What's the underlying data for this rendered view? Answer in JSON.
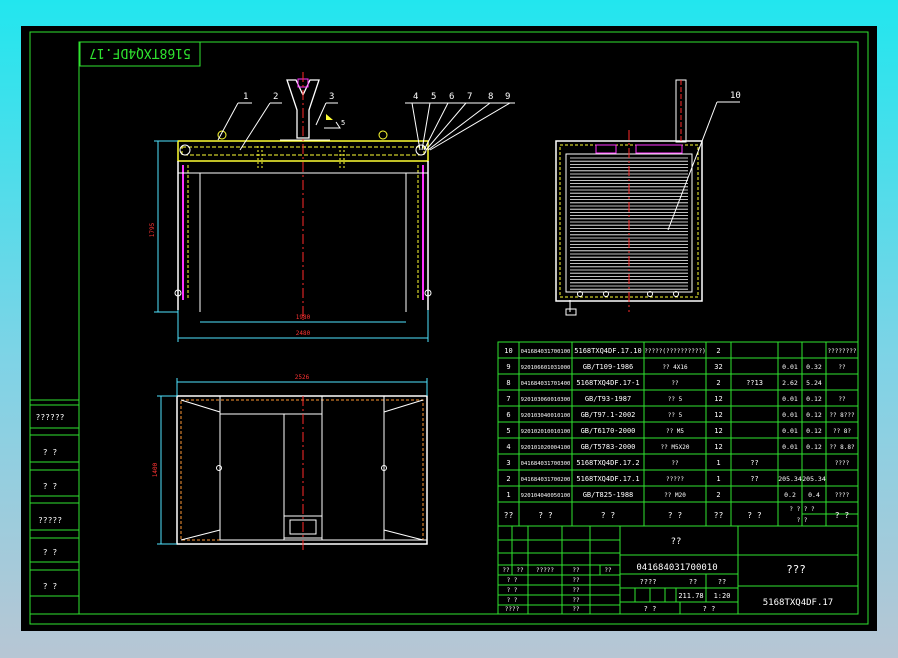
{
  "drawing": {
    "mirrored_title": "5168TXQ4DF.17",
    "side_view_labels": [
      "1",
      "2",
      "3",
      "4",
      "5",
      "6",
      "7",
      "8",
      "9"
    ],
    "side_view_dim_height": "1795",
    "side_view_dim_inner": "1980",
    "side_view_dim_width": "2480",
    "side_view_weld_symbol": "5",
    "end_view_label": "10",
    "top_view_dim_width": "2526",
    "top_view_dim_height": "1400",
    "left_block_cells": [
      "??????",
      "? ?",
      "? ?",
      "?????",
      "? ?",
      "? ?"
    ]
  },
  "bom": {
    "rows": [
      {
        "no": "10",
        "code": "041684031700100",
        "std": "5168TXQ4DF.17.10",
        "name": "?????(??????????)",
        "qty": "2",
        "mat": "",
        "unit": "",
        "total": "",
        "note": "????????"
      },
      {
        "no": "9",
        "code": "920106601031000",
        "std": "GB/T109-1986",
        "name": "?? 4X16",
        "qty": "32",
        "mat": "",
        "unit": "0.01",
        "total": "0.32",
        "note": "??"
      },
      {
        "no": "8",
        "code": "041684031701400",
        "std": "5168TXQ4DF.17-1",
        "name": "??",
        "qty": "2",
        "mat": "??13",
        "unit": "2.62",
        "total": "5.24",
        "note": ""
      },
      {
        "no": "7",
        "code": "920103060010300",
        "std": "GB/T93-1987",
        "name": "?? 5",
        "qty": "12",
        "mat": "",
        "unit": "0.01",
        "total": "0.12",
        "note": "??"
      },
      {
        "no": "6",
        "code": "920103040010100",
        "std": "GB/T97.1-2002",
        "name": "?? 5",
        "qty": "12",
        "mat": "",
        "unit": "0.01",
        "total": "0.12",
        "note": "?? 8???"
      },
      {
        "no": "5",
        "code": "920102010010100",
        "std": "GB/T6170-2000",
        "name": "?? M5",
        "qty": "12",
        "mat": "",
        "unit": "0.01",
        "total": "0.12",
        "note": "?? 8?"
      },
      {
        "no": "4",
        "code": "920101020004100",
        "std": "GB/T5783-2000",
        "name": "?? M5X20",
        "qty": "12",
        "mat": "",
        "unit": "0.01",
        "total": "0.12",
        "note": "?? 8.8?"
      },
      {
        "no": "3",
        "code": "041684031700300",
        "std": "5168TXQ4DF.17.2",
        "name": "??",
        "qty": "1",
        "mat": "??",
        "unit": "",
        "total": "",
        "note": "????"
      },
      {
        "no": "2",
        "code": "041684031700200",
        "std": "5168TXQ4DF.17.1",
        "name": "?????",
        "qty": "1",
        "mat": "??",
        "unit": "205.34",
        "total": "205.34",
        "note": ""
      },
      {
        "no": "1",
        "code": "920104040050100",
        "std": "GB/T825-1988",
        "name": "?? M20",
        "qty": "2",
        "mat": "",
        "unit": "0.2",
        "total": "0.4",
        "note": "????"
      }
    ],
    "header": {
      "no": "??",
      "code": "? ?",
      "std": "? ?",
      "name": "? ?",
      "qty": "??",
      "mat": "? ?",
      "unit_total_top": "? ?   ? ?",
      "unit_total_bottom": "? ?",
      "note": "? ?"
    }
  },
  "title_block": {
    "product_name": "??",
    "drawing_code": "041684031700010",
    "part_title": "???",
    "drawing_no": "5168TXQ4DF.17",
    "rev_headers": [
      "??",
      "??",
      "?????",
      "??",
      "??"
    ],
    "stage_label": "????",
    "weight_label": "??",
    "scale_label": "??",
    "weight_value": "211.78",
    "scale_value": "1:20",
    "row_labels": [
      "? ?",
      "? ?",
      "? ?",
      "? ?",
      "????"
    ],
    "sheet_label": "? ?",
    "sheet_value": "? ?",
    "sign_cells": [
      "??",
      "??",
      "??",
      "??",
      "??"
    ]
  },
  "colors": {
    "paper": "#000000",
    "frame": "#2fe32f",
    "cyan_dim": "#4fe3ff",
    "yellow": "#ffff33",
    "red": "#ff2a2a",
    "magenta": "#ff33ff",
    "orange": "#ff9933",
    "white": "#ffffff"
  }
}
